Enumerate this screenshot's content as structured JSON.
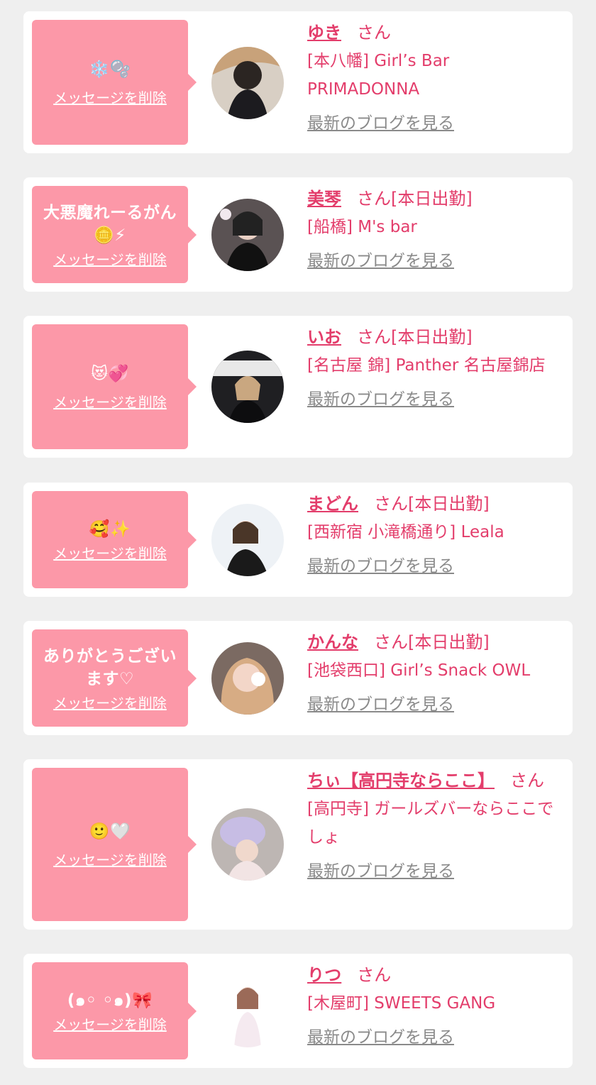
{
  "colors": {
    "background": "#efefef",
    "card": "#ffffff",
    "bubble": "#fc98a8",
    "accent_text": "#e33d6b",
    "link_gray": "#8a8a8a"
  },
  "labels": {
    "delete_message": "メッセージを削除",
    "latest_blog": "最新のブログを見る"
  },
  "items": [
    {
      "message": "❄️🫧",
      "name": "ゆき",
      "honorific": "さん",
      "shop": "[本八幡] Girl’s Bar PRIMADONNA",
      "avatar_icon": "profile-photo-icon"
    },
    {
      "message": "大悪魔れーるがん🪙⚡",
      "name": "美琴",
      "honorific": "さん[本日出勤]",
      "shop": "[船橋] M's bar",
      "avatar_icon": "profile-photo-icon"
    },
    {
      "message": "😻💞",
      "name": "いお",
      "honorific": "さん[本日出勤]",
      "shop": "[名古屋 錦] Panther 名古屋錦店",
      "avatar_icon": "profile-photo-icon"
    },
    {
      "message": "🥰✨",
      "name": "まどん",
      "honorific": "さん[本日出勤]",
      "shop": "[西新宿 小滝橋通り] Leala",
      "avatar_icon": "profile-photo-icon"
    },
    {
      "message": "ありがとうございます♡",
      "name": "かんな",
      "honorific": "さん[本日出勤]",
      "shop": "[池袋西口] Girl’s Snack OWL",
      "avatar_icon": "profile-photo-icon"
    },
    {
      "message": "🙂🤍",
      "name": "ちぃ【高円寺ならここ】",
      "honorific": "さん",
      "shop": "[高円寺] ガールズバーならここでしょ",
      "avatar_icon": "profile-photo-icon"
    },
    {
      "message": "(๑◦ ◦๑)🎀",
      "name": "りつ",
      "honorific": "さん",
      "shop": "[木屋町] SWEETS GANG",
      "avatar_icon": "profile-photo-icon"
    }
  ]
}
